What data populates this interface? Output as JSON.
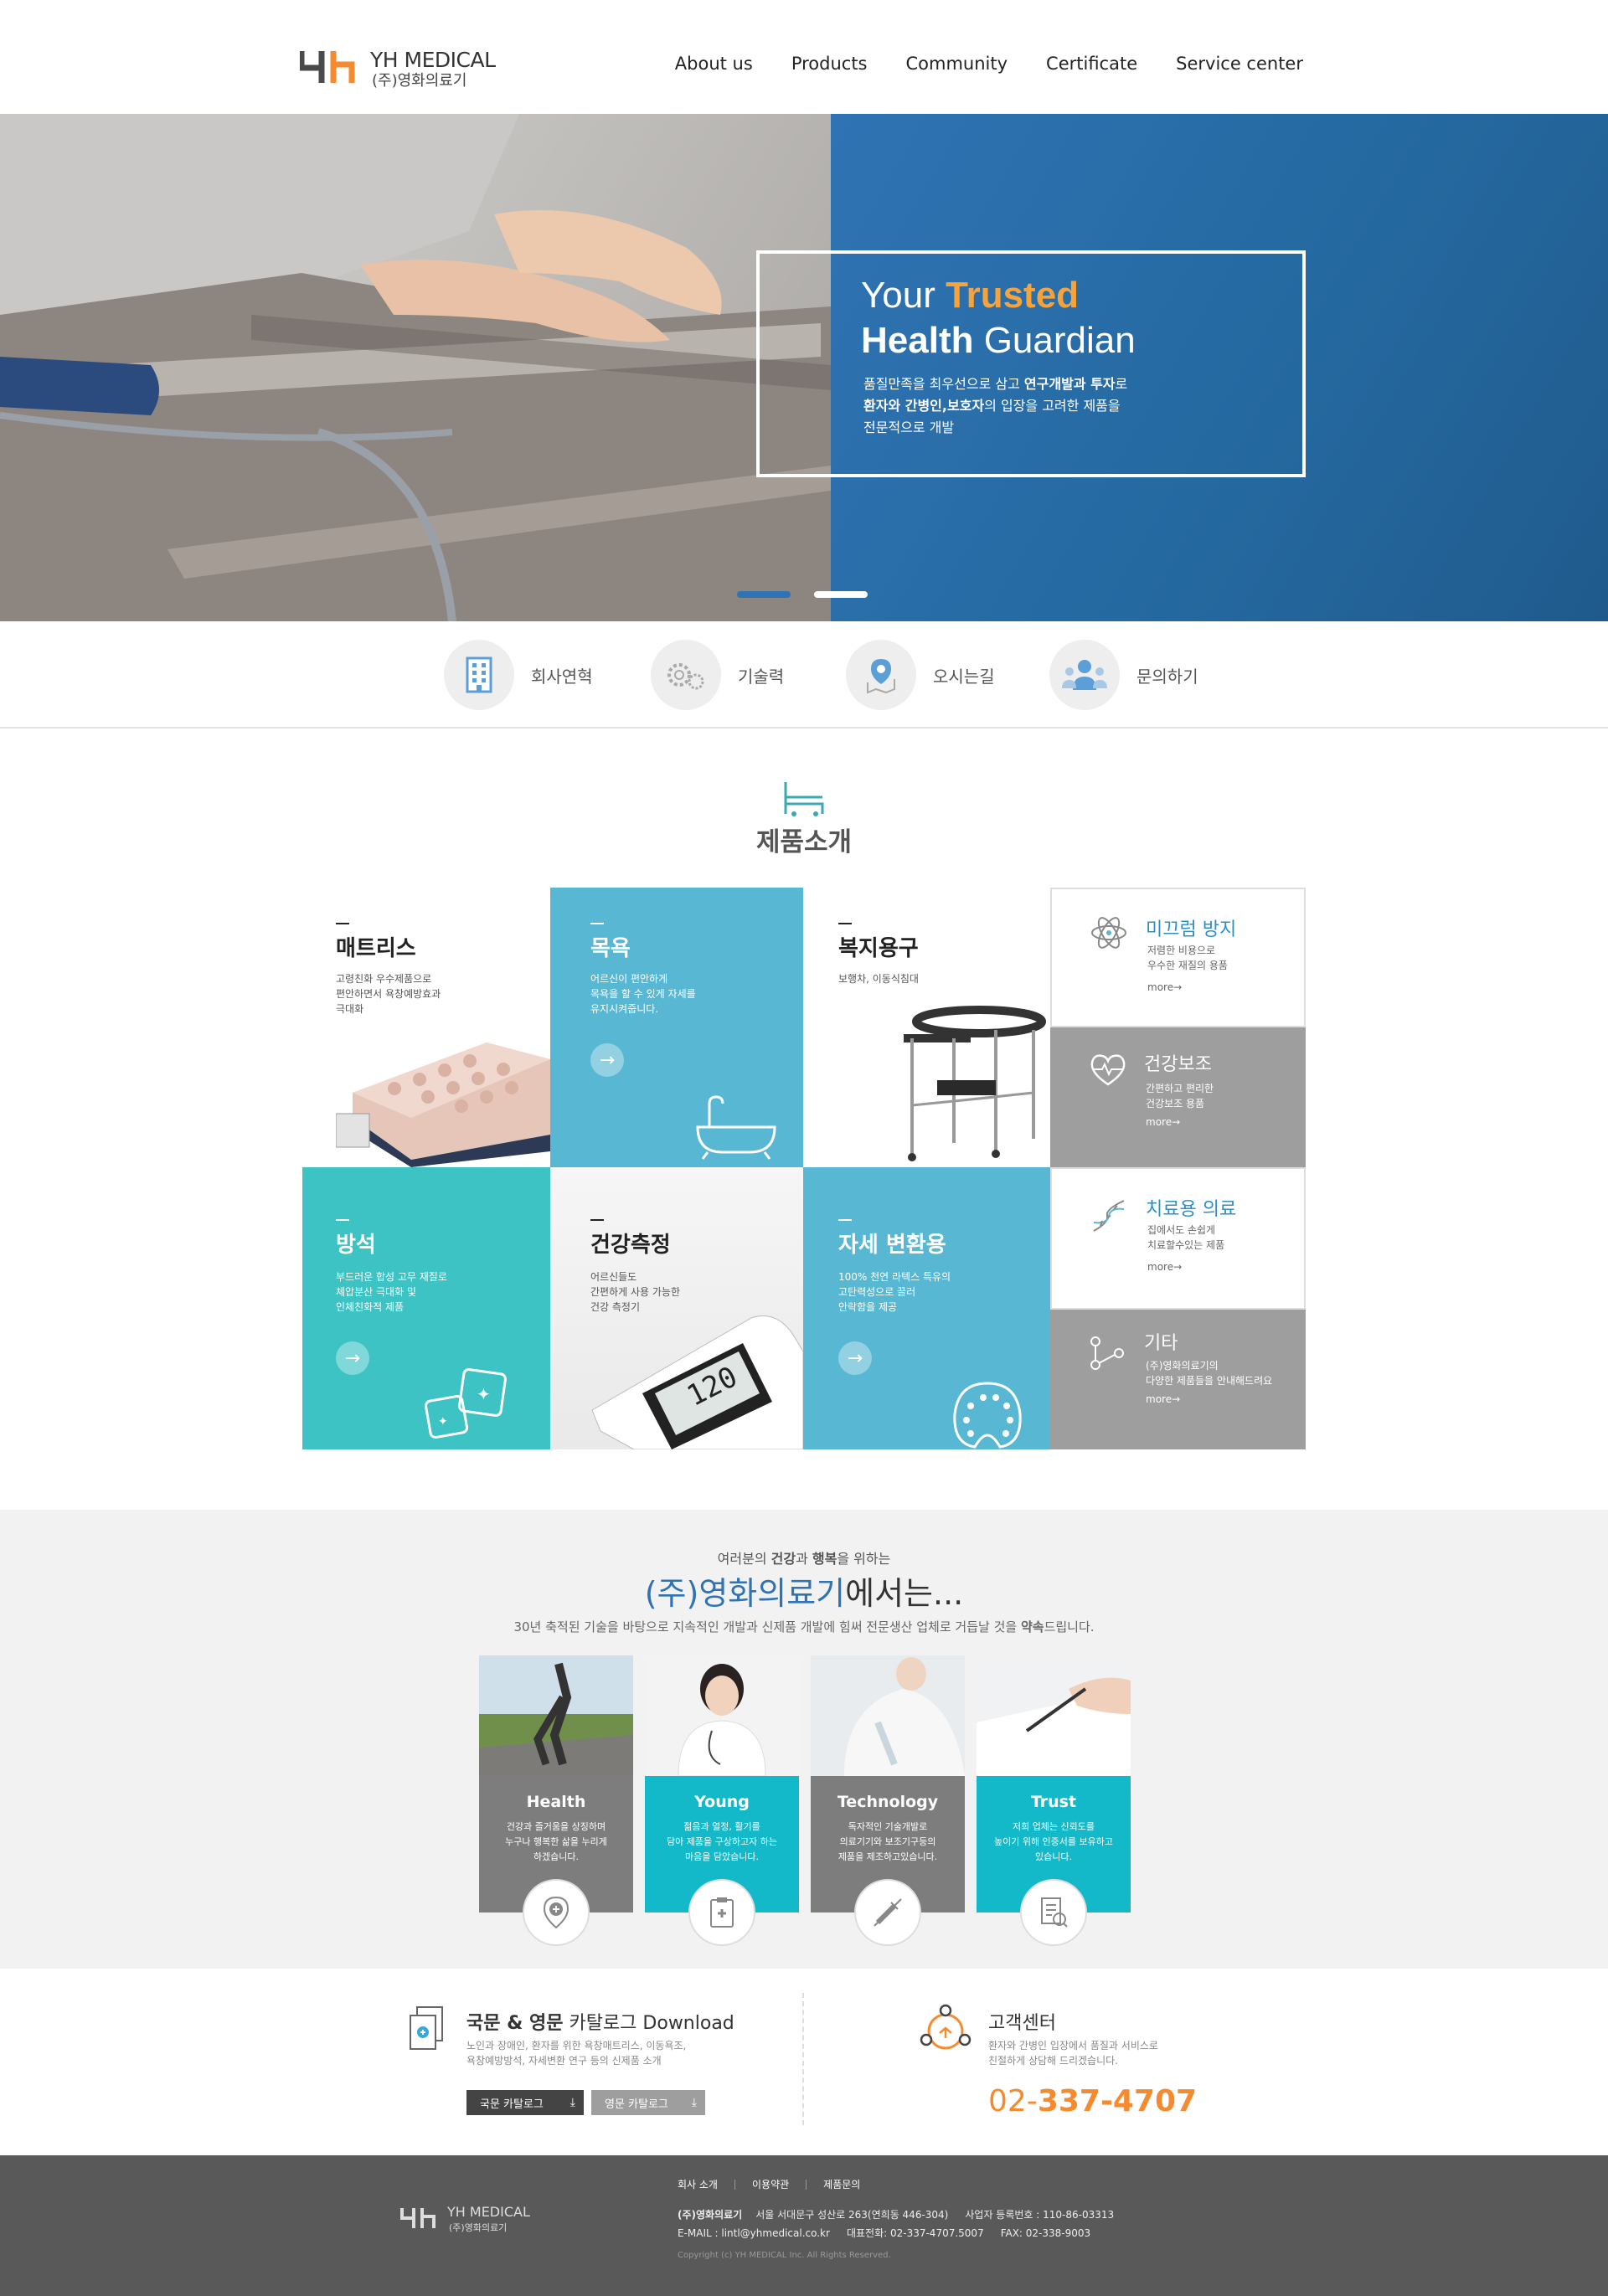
{
  "header": {
    "logo_en": "YH MEDICAL",
    "logo_ko": "(주)영화의료기",
    "nav": [
      "About us",
      "Products",
      "Community",
      "Certificate",
      "Service center"
    ]
  },
  "hero": {
    "title_line1_a": "Your ",
    "title_line1_b": "Trusted",
    "title_line2_a": "Health",
    "title_line2_b": " Guardian",
    "desc_1a": "품질만족을 최우선으로 삼고 ",
    "desc_1b": "연구개발과 투자",
    "desc_1c": "로",
    "desc_2a": "환자와 간병인,보호자",
    "desc_2b": "의 입장을 고려한 제품을",
    "desc_3": "전문적으로 개발",
    "slides": 2,
    "active_slide": 1
  },
  "quick": [
    {
      "label": "회사연혁",
      "icon": "building-icon"
    },
    {
      "label": "기술력",
      "icon": "gears-icon"
    },
    {
      "label": "오시는길",
      "icon": "map-pin-icon"
    },
    {
      "label": "문의하기",
      "icon": "people-icon"
    }
  ],
  "products": {
    "title": "제품소개",
    "tiles": {
      "mattress": {
        "title": "매트리스",
        "d1": "고령친화 우수제품으로",
        "d2": "편안하면서 욕창예방효과",
        "d3": "극대화"
      },
      "bath": {
        "title": "목욕",
        "d1": "어르신이 편안하게",
        "d2": "목욕을 할 수 있게 자세를",
        "d3": "유지시켜줍니다."
      },
      "welfare": {
        "title": "복지용구",
        "d1": "보행차, 이동식침대"
      },
      "cushion": {
        "title": "방석",
        "d1": "부드러운 합성 고무 재질로",
        "d2": "체압분산 극대화 및",
        "d3": "인체친화적 제품"
      },
      "measure": {
        "title": "건강측정",
        "d1": "어르신들도",
        "d2": "간편하게 사용 가능한",
        "d3": "건강 측정기"
      },
      "posture": {
        "title": "자세 변환용",
        "d1": "100% 천연 라텍스 특유의",
        "d2": "고탄력성으로 끌러",
        "d3": "안락함을 제공"
      }
    },
    "side": [
      {
        "title": "미끄럼 방지",
        "d1": "저렴한 비용으로",
        "d2": "우수한 재질의 용품",
        "more": "more→",
        "icon": "atom-icon"
      },
      {
        "title": "건강보조",
        "d1": "간편하고 편리한",
        "d2": "건강보조 용품",
        "more": "more→",
        "icon": "heart-pulse-icon"
      },
      {
        "title": "치료용 의료",
        "d1": "집에서도 손쉽게",
        "d2": "치료할수있는 제품",
        "more": "more→",
        "icon": "dna-icon"
      },
      {
        "title": "기타",
        "d1": "(주)영화의료기의",
        "d2": "다양한 제품들을 안내해드려요",
        "more": "more→",
        "icon": "share-nodes-icon"
      }
    ]
  },
  "about": {
    "sub_a": "여러분의 ",
    "sub_b": "건강",
    "sub_c": "과 ",
    "sub_d": "행복",
    "sub_e": "을 위하는",
    "title_a": "(주)영화의료기",
    "title_b": "에서는...",
    "desc_a": "30년 축적된 기술을 바탕으로 지속적인 개발과 신제품 개발에 힘써 전문생산 업체로 거듭날 것을 ",
    "desc_b": "약속",
    "desc_c": "드립니다.",
    "cards": [
      {
        "name": "Health",
        "t1": "건강과 즐거움을 상징하며",
        "t2": "누구나 행복한 삶을 누리게",
        "t3": "하겠습니다.",
        "color": "#7d7d7d",
        "icon": "pin-plus-icon"
      },
      {
        "name": "Young",
        "t1": "젊음과 열정, 활기를",
        "t2": "담아 제품을 구상하고자 하는",
        "t3": "마음을 담았습니다.",
        "color": "#13b9c8",
        "icon": "clipboard-icon"
      },
      {
        "name": "Technology",
        "t1": "독자적인 기술개발로",
        "t2": "의료기기와 보조기구등의",
        "t3": "제품을 제조하고있습니다.",
        "color": "#7d7d7d",
        "icon": "syringe-icon"
      },
      {
        "name": "Trust",
        "t1": "저희 업체는 신뢰도를",
        "t2": "높이기 위해 인증서를 보유하고",
        "t3": "있습니다.",
        "color": "#13b9c8",
        "icon": "certificate-icon"
      }
    ]
  },
  "download": {
    "title_a": "국문 & 영문",
    "title_b": " 카탈로그 Download",
    "d1": "노인과 장애인, 환자를 위한 욕창매트리스, 이동욕조,",
    "d2": "욕창예방방석, 자세변환 연구 등의 신제품 소개",
    "btn_ko": "국문 카탈로그",
    "btn_en": "영문 카탈로그"
  },
  "service": {
    "title": "고객센터",
    "d1": "환자와 간병인 입장에서 품질과 서비스로",
    "d2": "친절하게 상담해 드리겠습니다.",
    "phone_a": "02-",
    "phone_b": "337-4707"
  },
  "footer": {
    "logo_en": "YH MEDICAL",
    "logo_ko": "(주)영화의료기",
    "links": [
      "회사 소개",
      "이용약관",
      "제품문의"
    ],
    "company": "(주)영화의료기",
    "address": "서울 서대문구 성산로 263(연희동 446-304)",
    "biz_no": "사업자 등록번호 : 110-86-03313",
    "email": "E-MAIL : lintl@yhmedical.co.kr",
    "tel": "대표전화: 02-337-4707.5007",
    "fax": "FAX: 02-338-9003",
    "copyright": "Copyright (c) YH MEDICAL Inc. All Rights Reserved."
  },
  "colors": {
    "brand_blue": "#2f73b4",
    "accent_orange": "#f58a2e",
    "teal": "#3ec5c5",
    "sky": "#5bb7d3",
    "gray": "#9e9e9e",
    "footer": "#595959"
  }
}
